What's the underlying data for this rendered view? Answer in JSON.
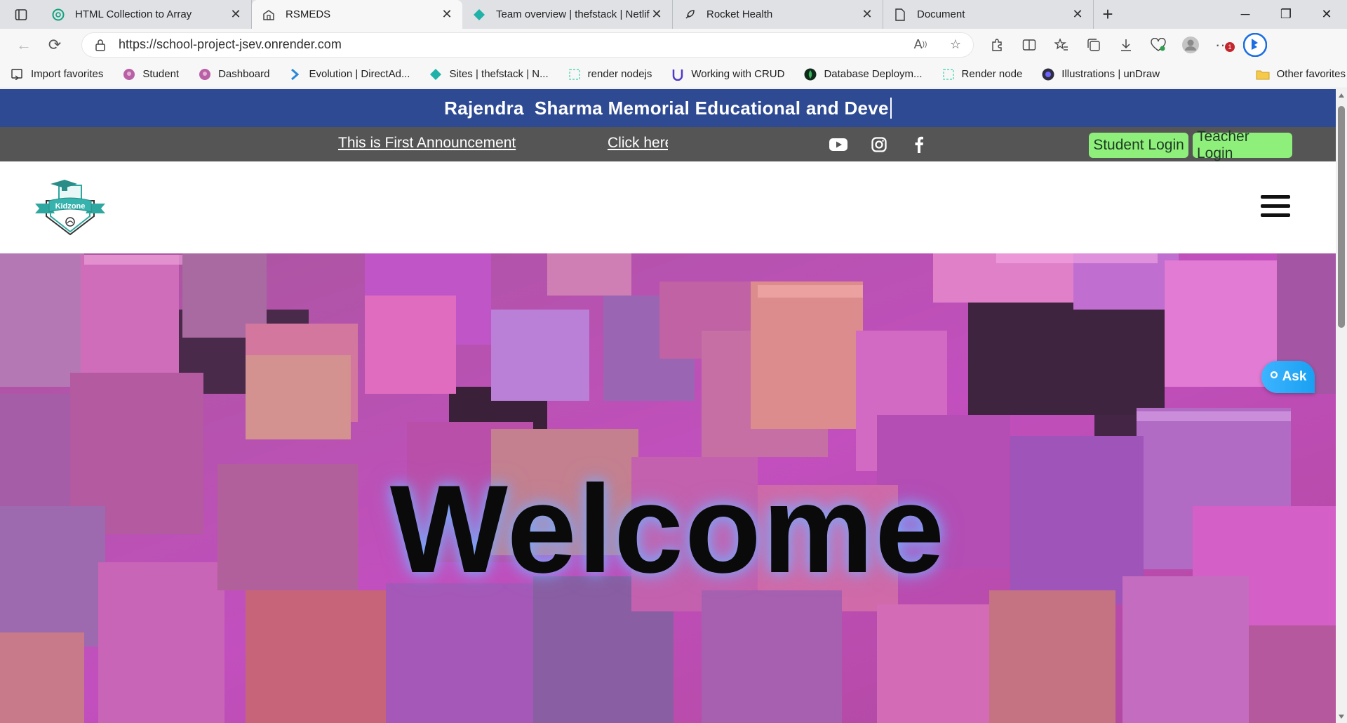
{
  "browser": {
    "tabs": [
      {
        "title": "HTML Collection to Array",
        "icon": "chatgpt-icon"
      },
      {
        "title": "RSMEDS",
        "icon": "school-icon",
        "active": true
      },
      {
        "title": "Team overview | thefstack | Netlif",
        "icon": "netlify-icon"
      },
      {
        "title": "Rocket Health",
        "icon": "rocket-icon"
      },
      {
        "title": "Document",
        "icon": "document-icon"
      }
    ],
    "url": "https://school-project-jsev.onrender.com",
    "favorites": [
      {
        "label": "Import favorites",
        "icon": "import-icon"
      },
      {
        "label": "Student",
        "icon": "globe-icon"
      },
      {
        "label": "Dashboard",
        "icon": "globe-icon"
      },
      {
        "label": "Evolution | DirectAd...",
        "icon": "arrow-icon"
      },
      {
        "label": "Sites | thefstack | N...",
        "icon": "netlify-icon"
      },
      {
        "label": "render nodejs",
        "icon": "render-icon"
      },
      {
        "label": "Working with CRUD",
        "icon": "u-icon"
      },
      {
        "label": "Database Deploym...",
        "icon": "mongodb-icon"
      },
      {
        "label": "Render node",
        "icon": "render-icon"
      },
      {
        "label": "Illustrations | unDraw",
        "icon": "undraw-icon"
      }
    ],
    "other_favorites": "Other favorites",
    "notification_badge": "1"
  },
  "site": {
    "banner_title": "Rajendra  Sharma Memorial Educational and Deve",
    "announcement": "This is First Announcement",
    "announcement_link": "Click here",
    "social": [
      "youtube-icon",
      "instagram-icon",
      "facebook-icon"
    ],
    "student_login": "Student Login",
    "teacher_login": "Teacher Login",
    "logo_text": "Kidzone",
    "hero_title": "Welcome",
    "ask_button": "Ask"
  },
  "colors": {
    "banner": "#2e4a93",
    "announce_bar": "#555555",
    "login_button": "#8ef07a",
    "ask_button": "#1aa0f2"
  }
}
